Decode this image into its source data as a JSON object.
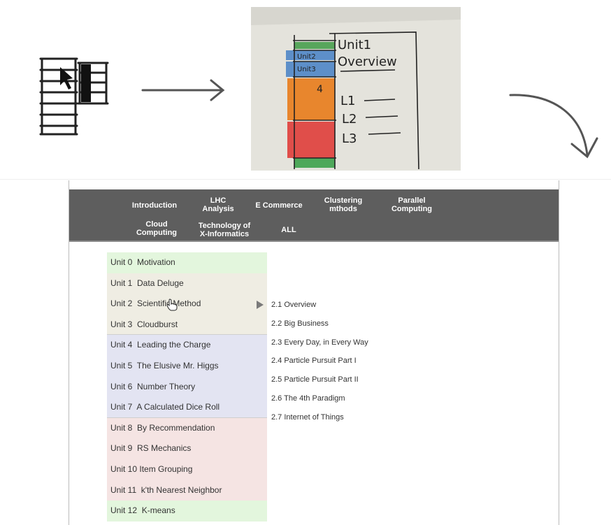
{
  "colors": {
    "nav_background": "#5e5e5e",
    "group_green": "#e3f6dd",
    "group_tan": "#efede3",
    "group_blue": "#e3e4f2",
    "group_pink": "#f5e4e3"
  },
  "sketch": {
    "note": "",
    "labels": [
      "Unit1",
      "Overview",
      "L1",
      "L2",
      "L3",
      "Unit2",
      "Unit3",
      "4"
    ]
  },
  "navbar": {
    "items": [
      {
        "label": "Introduction"
      },
      {
        "label": "LHC\nAnalysis"
      },
      {
        "label": "E Commerce"
      },
      {
        "label": "Clustering\nmthods"
      },
      {
        "label": "Parallel\nComputing"
      },
      {
        "label": "Cloud\nComputing"
      },
      {
        "label": "Technology of\nX-Informatics"
      },
      {
        "label": "ALL"
      }
    ]
  },
  "units": [
    {
      "label": "Unit 0  Motivation",
      "color": "#e3f6dd"
    },
    {
      "label": "Unit 1  Data Deluge",
      "color": "#efede3"
    },
    {
      "label": "Unit 2  Scientific Method",
      "color": "#efede3"
    },
    {
      "label": "Unit 3  Cloudburst",
      "color": "#efede3"
    },
    {
      "label": "Unit 4  Leading the Charge",
      "color": "#e3e4f2"
    },
    {
      "label": "Unit 5  The Elusive Mr. Higgs",
      "color": "#e3e4f2"
    },
    {
      "label": "Unit 6  Number Theory",
      "color": "#e3e4f2"
    },
    {
      "label": "Unit 7  A Calculated Dice Roll",
      "color": "#e3e4f2"
    },
    {
      "label": "Unit 8  By Recommendation",
      "color": "#f5e4e3"
    },
    {
      "label": "Unit 9  RS Mechanics",
      "color": "#f5e4e3"
    },
    {
      "label": "Unit 10 Item Grouping",
      "color": "#f5e4e3"
    },
    {
      "label": "Unit 11  k'th Nearest Neighbor",
      "color": "#f5e4e3"
    },
    {
      "label": "Unit 12  K-means",
      "color": "#e3f6dd"
    }
  ],
  "lessons": [
    {
      "label": "2.1 Overview"
    },
    {
      "label": "2.2 Big Business"
    },
    {
      "label": "2.3 Every Day, in Every Way"
    },
    {
      "label": "2.4 Particle Pursuit Part I"
    },
    {
      "label": "2.5 Particle Pursuit Part II"
    },
    {
      "label": "2.6 The 4th Paradigm"
    },
    {
      "label": "2.7 Internet of Things"
    }
  ]
}
